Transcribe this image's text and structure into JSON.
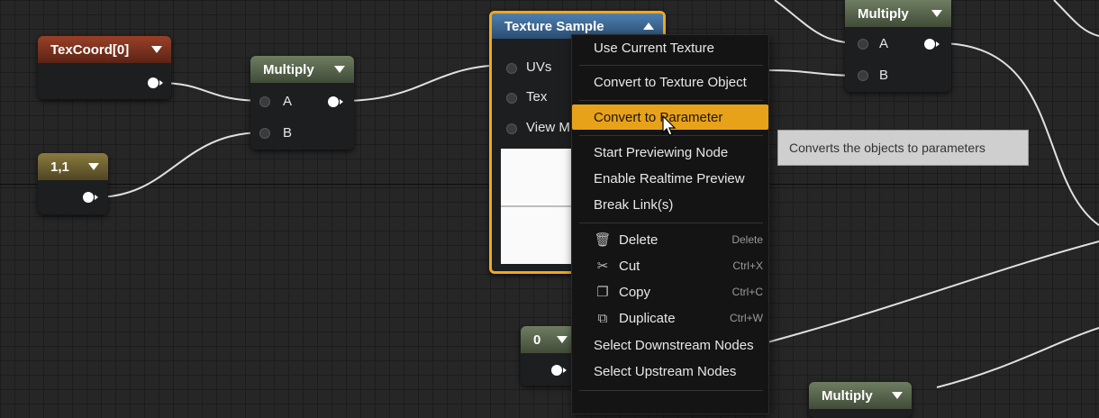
{
  "nodes": {
    "texcoord": {
      "title": "TexCoord[0]"
    },
    "constant2": {
      "title": "1,1"
    },
    "multiply_mid": {
      "title": "Multiply",
      "pin_a": "A",
      "pin_b": "B"
    },
    "texture_sample": {
      "title": "Texture Sample",
      "pins": [
        "UVs",
        "Tex",
        "View M"
      ]
    },
    "multiply_top": {
      "title": "Multiply",
      "pin_a": "A",
      "pin_b": "B"
    },
    "constant0": {
      "title": "0"
    },
    "multiply_bottom": {
      "title": "Multiply"
    }
  },
  "context_menu": {
    "items": [
      {
        "label": "Use Current Texture"
      },
      {
        "label": "Convert to Texture Object"
      },
      {
        "label": "Convert to Parameter",
        "highlighted": true
      },
      {
        "label": "Start Previewing Node"
      },
      {
        "label": "Enable Realtime Preview"
      },
      {
        "label": "Break Link(s)"
      },
      {
        "label": "Delete",
        "shortcut": "Delete",
        "icon": "delete-icon"
      },
      {
        "label": "Cut",
        "shortcut": "Ctrl+X",
        "icon": "scissors-icon"
      },
      {
        "label": "Copy",
        "shortcut": "Ctrl+C",
        "icon": "copy-icon"
      },
      {
        "label": "Duplicate",
        "shortcut": "Ctrl+W",
        "icon": "duplicate-icon"
      },
      {
        "label": "Select Downstream Nodes"
      },
      {
        "label": "Select Upstream Nodes"
      }
    ]
  },
  "tooltip": {
    "text": "Converts the objects to parameters"
  },
  "colors": {
    "background": "#262626",
    "selection_outline": "#f0a81c",
    "menu_highlight": "#e8a21a",
    "texcoord_header": "#9a4026",
    "multiply_header": "#6e7d61",
    "constant_header": "#8a7b3e",
    "texture_header": "#4e7fb0"
  }
}
